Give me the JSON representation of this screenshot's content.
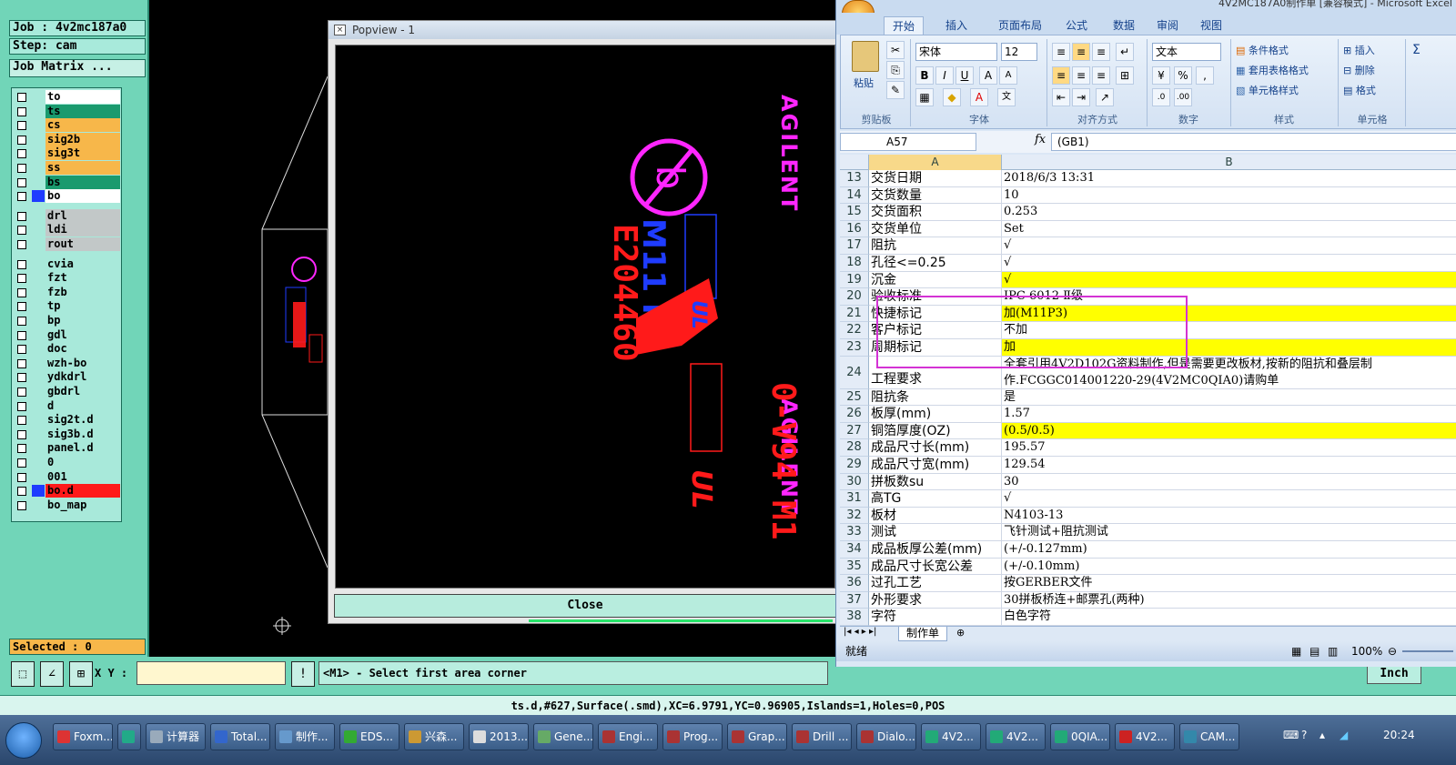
{
  "cam": {
    "job": "Job : 4v2mc187a0",
    "step": "Step: cam",
    "job_matrix": "Job Matrix ...",
    "selected": "Selected : 0",
    "xy_label": "X Y :",
    "xy_value": "",
    "prompt": "<M1> - Select first area corner",
    "units": "Inch",
    "status": "ts.d,#627,Surface(.smd),XC=6.9791,YC=0.96905,Islands=1,Holes=0,POS",
    "layers": [
      {
        "name": "to",
        "color": "#ffffff",
        "swatch": ""
      },
      {
        "name": "ts",
        "color": "#1a9a6e",
        "swatch": ""
      },
      {
        "name": "cs",
        "color": "#f7b74a",
        "swatch": ""
      },
      {
        "name": "sig2b",
        "color": "#f7b74a",
        "swatch": ""
      },
      {
        "name": "sig3t",
        "color": "#f7b74a",
        "swatch": ""
      },
      {
        "name": "ss",
        "color": "#f7b74a",
        "swatch": ""
      },
      {
        "name": "bs",
        "color": "#1a9a6e",
        "swatch": ""
      },
      {
        "name": "bo",
        "color": "#ffffff",
        "swatch": "#1f3cff"
      },
      {
        "name": "drl",
        "color": "#c2c8c8",
        "swatch": ""
      },
      {
        "name": "ldi",
        "color": "#c2c8c8",
        "swatch": ""
      },
      {
        "name": "rout",
        "color": "#c2c8c8",
        "swatch": ""
      },
      {
        "name": "cvia",
        "color": "#a8e9da",
        "swatch": ""
      },
      {
        "name": "fzt",
        "color": "#a8e9da",
        "swatch": ""
      },
      {
        "name": "fzb",
        "color": "#a8e9da",
        "swatch": ""
      },
      {
        "name": "tp",
        "color": "#a8e9da",
        "swatch": ""
      },
      {
        "name": "bp",
        "color": "#a8e9da",
        "swatch": ""
      },
      {
        "name": "gdl",
        "color": "#a8e9da",
        "swatch": ""
      },
      {
        "name": "doc",
        "color": "#a8e9da",
        "swatch": ""
      },
      {
        "name": "wzh-bo",
        "color": "#a8e9da",
        "swatch": ""
      },
      {
        "name": "ydkdrl",
        "color": "#a8e9da",
        "swatch": ""
      },
      {
        "name": "gbdrl",
        "color": "#a8e9da",
        "swatch": ""
      },
      {
        "name": "d",
        "color": "#a8e9da",
        "swatch": ""
      },
      {
        "name": "sig2t.d",
        "color": "#a8e9da",
        "swatch": ""
      },
      {
        "name": "sig3b.d",
        "color": "#a8e9da",
        "swatch": ""
      },
      {
        "name": "panel.d",
        "color": "#a8e9da",
        "swatch": ""
      },
      {
        "name": "0",
        "color": "#a8e9da",
        "swatch": ""
      },
      {
        "name": "001",
        "color": "#a8e9da",
        "swatch": ""
      },
      {
        "name": "bo.d",
        "color": "#ff1a1a",
        "swatch": "#1f3cff"
      },
      {
        "name": "bo_map",
        "color": "#a8e9da",
        "swatch": ""
      }
    ]
  },
  "popview": {
    "title": "Popview - 1",
    "close": "Close",
    "silk_text_1": "AGILENT",
    "silk_text_2": "AGILENT",
    "red_text_1": "E204460",
    "red_text_2": "0-V94 M1",
    "blue_text": "M11 P3",
    "ul_mark": "UL"
  },
  "excel": {
    "title": "4V2MC187A0制作单 [兼容模式] - Microsoft Excel",
    "tabs": [
      "开始",
      "插入",
      "页面布局",
      "公式",
      "数据",
      "审阅",
      "视图"
    ],
    "ribbon": {
      "paste": "粘贴",
      "clipboard": "剪贴板",
      "font_name": "宋体",
      "font_size": "12",
      "font": "字体",
      "alignment": "对齐方式",
      "number_format": "文本",
      "number": "数字",
      "cond_format": "条件格式",
      "table_format": "套用表格格式",
      "cell_style": "单元格样式",
      "styles": "样式",
      "insert": "插入",
      "delete": "删除",
      "format": "格式",
      "cells": "单元格"
    },
    "name_box": "A57",
    "fx": "fx",
    "formula": "(GB1)",
    "col_a": "A",
    "col_b": "B",
    "rows": [
      {
        "n": "13",
        "a": "交货日期",
        "b": "2018/6/3 13:31",
        "hl": false
      },
      {
        "n": "14",
        "a": "交货数量",
        "b": "10",
        "hl": false
      },
      {
        "n": "15",
        "a": "交货面积",
        "b": "0.253",
        "hl": false
      },
      {
        "n": "16",
        "a": "交货单位",
        "b": "Set",
        "hl": false
      },
      {
        "n": "17",
        "a": "阻抗",
        "b": "√",
        "hl": false
      },
      {
        "n": "18",
        "a": "孔径<=0.25",
        "b": "√",
        "hl": false
      },
      {
        "n": "19",
        "a": "沉金",
        "b": "√",
        "hl": true
      },
      {
        "n": "20",
        "a": "验收标准",
        "b": "IPC 6012 Ⅱ级",
        "hl": false
      },
      {
        "n": "21",
        "a": "快捷标记",
        "b": "加(M11P3)",
        "hl": true
      },
      {
        "n": "22",
        "a": "客户标记",
        "b": "不加",
        "hl": false
      },
      {
        "n": "23",
        "a": "周期标记",
        "b": "加",
        "hl": true
      },
      {
        "n": "24",
        "a": "工程要求",
        "b": "全套引用4V2D102G资料制作,但是需要更改板材,按新的阻抗和叠层制",
        "b2": "作.FCGGC014001220-29(4V2MC0QIA0)请购单",
        "hl": false,
        "tall": true
      },
      {
        "n": "25",
        "a": "阻抗条",
        "b": "是",
        "hl": false
      },
      {
        "n": "26",
        "a": "板厚(mm)",
        "b": "1.57",
        "hl": false
      },
      {
        "n": "27",
        "a": "铜箔厚度(OZ)",
        "b": "(0.5/0.5)",
        "hl": true
      },
      {
        "n": "28",
        "a": "成品尺寸长(mm)",
        "b": "195.57",
        "hl": false
      },
      {
        "n": "29",
        "a": "成品尺寸宽(mm)",
        "b": "129.54",
        "hl": false
      },
      {
        "n": "30",
        "a": "拼板数su",
        "b": "30",
        "hl": false
      },
      {
        "n": "31",
        "a": "高TG",
        "b": "√",
        "hl": false
      },
      {
        "n": "32",
        "a": "板材",
        "b": "N4103-13",
        "hl": false
      },
      {
        "n": "33",
        "a": "测试",
        "b": "飞针测试+阻抗测试",
        "hl": false
      },
      {
        "n": "34",
        "a": "成品板厚公差(mm)",
        "b": "(+/-0.127mm)",
        "hl": false
      },
      {
        "n": "35",
        "a": "成品尺寸长宽公差",
        "b": "(+/-0.10mm)",
        "hl": false
      },
      {
        "n": "36",
        "a": "过孔工艺",
        "b": "按GERBER文件",
        "hl": false
      },
      {
        "n": "37",
        "a": "外形要求",
        "b": "30拼板桥连+邮票孔(两种)",
        "hl": false
      },
      {
        "n": "38",
        "a": "字符",
        "b": "白色字符",
        "hl": false
      }
    ],
    "sheet_tab": "制作单",
    "status_ready": "就绪",
    "zoom": "100%"
  },
  "taskbar": {
    "items": [
      {
        "label": "Foxm...",
        "color": "#d33"
      },
      {
        "label": "",
        "color": "#2a8"
      },
      {
        "label": "计算器",
        "color": "#9ab"
      },
      {
        "label": "Total...",
        "color": "#36c"
      },
      {
        "label": "制作...",
        "color": "#69c"
      },
      {
        "label": "EDS...",
        "color": "#3a3"
      },
      {
        "label": "兴森...",
        "color": "#c93"
      },
      {
        "label": "2013...",
        "color": "#ddd"
      },
      {
        "label": "Gene...",
        "color": "#6a6"
      },
      {
        "label": "Engi...",
        "color": "#a33"
      },
      {
        "label": "Prog...",
        "color": "#a33"
      },
      {
        "label": "Grap...",
        "color": "#a33"
      },
      {
        "label": "Drill ...",
        "color": "#a33"
      },
      {
        "label": "Dialo...",
        "color": "#a33"
      },
      {
        "label": "4V2...",
        "color": "#2a7"
      },
      {
        "label": "4V2...",
        "color": "#2a7"
      },
      {
        "label": "0QIA...",
        "color": "#2a7"
      },
      {
        "label": "4V2...",
        "color": "#c22"
      },
      {
        "label": "CAM...",
        "color": "#38a"
      }
    ],
    "clock": "20:24"
  }
}
